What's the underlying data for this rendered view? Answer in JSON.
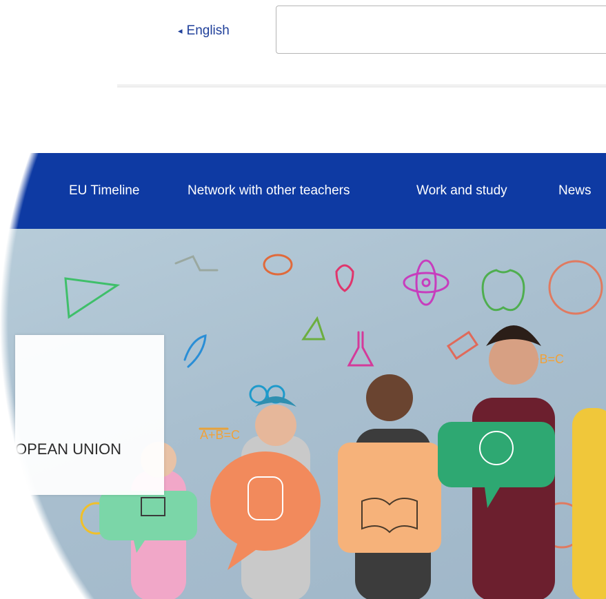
{
  "header": {
    "language_label": "English",
    "language_icon": "caret-left-icon",
    "search_value": "",
    "search_placeholder": ""
  },
  "nav": {
    "items": [
      {
        "label": "EU Timeline"
      },
      {
        "label": "Network with other teachers"
      },
      {
        "label": "Work and study"
      },
      {
        "label": "News"
      }
    ],
    "background_color": "#0e3aa3",
    "text_color": "#ffffff"
  },
  "hero": {
    "overlay_text": "OPEAN UNION"
  },
  "colors": {
    "link_blue": "#1f3f9a",
    "hero_bg": "#a9bfcf"
  }
}
